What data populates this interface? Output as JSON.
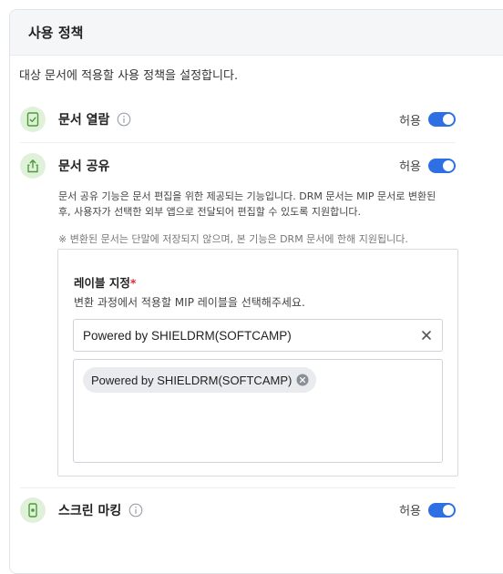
{
  "panel": {
    "title": "사용 정책"
  },
  "description": "대상 문서에 적용할 사용 정책을 설정합니다.",
  "policies": {
    "view": {
      "label": "문서 열람",
      "status": "허용",
      "enabled": true,
      "icon": "document-check-icon"
    },
    "share": {
      "label": "문서 공유",
      "status": "허용",
      "enabled": true,
      "icon": "share-icon",
      "description_line1": "문서 공유 기능은 문서 편집을 위한 제공되는 기능입니다. DRM 문서는 MIP 문서로 변환된",
      "description_line2": "후, 사용자가 선택한 외부 앱으로 전달되어 편집할 수 있도록 지원합니다.",
      "note": "※ 변환된 문서는 단말에 저장되지 않으며, 본 기능은 DRM 문서에 한해 지원됩니다."
    },
    "screen_marking": {
      "label": "스크린 마킹",
      "status": "허용",
      "enabled": true,
      "icon": "screen-marking-icon"
    }
  },
  "label_assignment": {
    "title": "레이블 지정",
    "required_mark": "*",
    "hint": "변환 과정에서 적용할 MIP 레이블을 선택해주세요.",
    "select_value": "Powered by SHIELDRM(SOFTCAMP)",
    "selected_tags": [
      "Powered by SHIELDRM(SOFTCAMP)"
    ]
  },
  "colors": {
    "accent": "#2f6fe4",
    "icon_bg": "#dff1d8",
    "icon_fg": "#4c9a3a",
    "required": "#e0293b"
  }
}
